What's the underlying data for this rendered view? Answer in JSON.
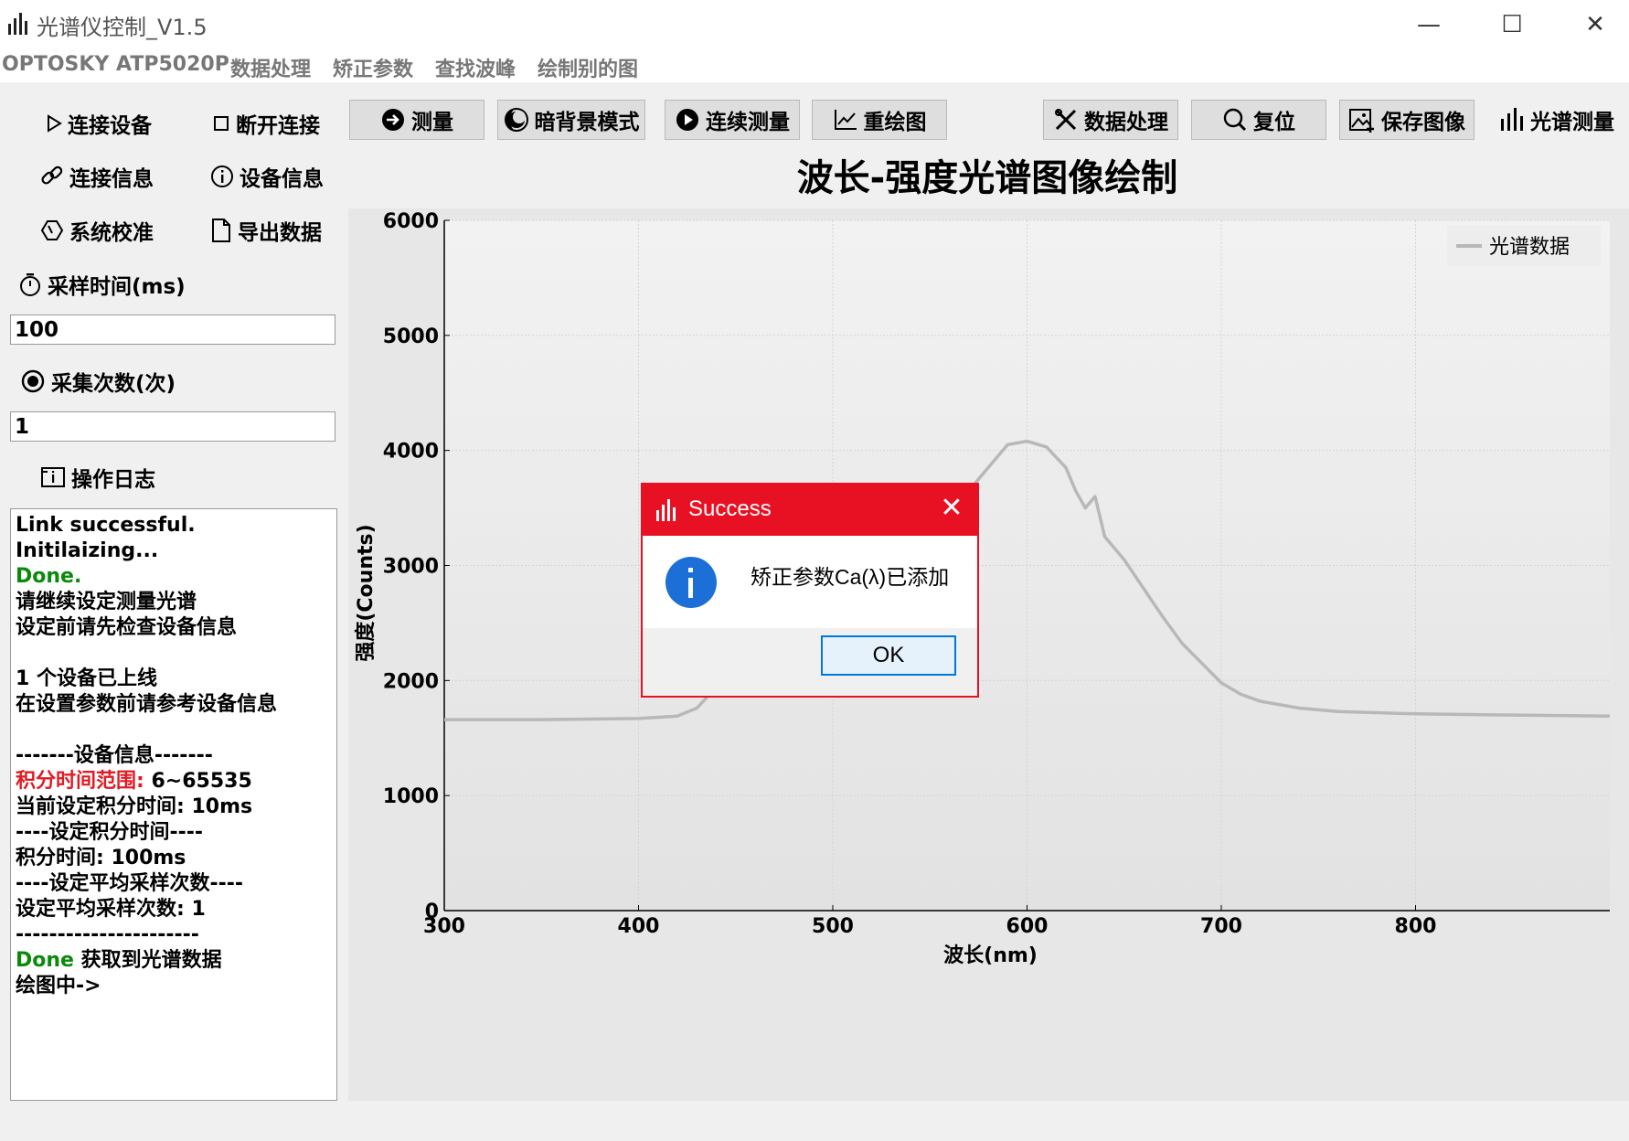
{
  "window": {
    "title": "光谱仪控制_V1.5",
    "icon": "spectrum-bars-icon",
    "controls": [
      "minimize-icon",
      "maximize-icon",
      "close-icon"
    ]
  },
  "menu": [
    "OPTOSKY ATP5020P",
    "数据处理",
    "矫正参数",
    "查找波峰",
    "绘制别的图"
  ],
  "sidebar": {
    "connect": "连接设备",
    "disconnect": "断开连接",
    "link_info": "连接信息",
    "device_info": "设备信息",
    "calibrate": "系统校准",
    "export": "导出数据",
    "sample_time_label": "采样时间(ms)",
    "sample_time_value": "100",
    "collect_count_label": "采集次数(次)",
    "collect_count_value": "1",
    "log_label": "操作日志"
  },
  "log": {
    "l1": "Link successful.",
    "l2": "Initilaizing...",
    "l3": "Done.",
    "l4": "请继续设定测量光谱",
    "l5": "设定前请先检查设备信息",
    "l6": "1 个设备已上线",
    "l7": "在设置参数前请参考设备信息",
    "l8": "-------设备信息-------",
    "l9a": "积分时间范围:",
    "l9b": " 6~65535",
    "l10": "当前设定积分时间: 10ms",
    "l11": "----设定积分时间----",
    "l12": "积分时间: 100ms",
    "l13": "----设定平均采样次数----",
    "l14": "设定平均采样次数: 1",
    "l15": "----------------------",
    "l16a": "Done",
    "l16b": " 获取到光谱数据",
    "l17": "绘图中->"
  },
  "toolbar": {
    "measure": "测量",
    "dark_mode": "暗背景模式",
    "continuous": "连续测量",
    "redraw": "重绘图",
    "data_processing": "数据处理",
    "reset": "复位",
    "save_image": "保存图像",
    "spectrum_measure": "光谱测量"
  },
  "chart_data": {
    "type": "line",
    "title": "波长-强度光谱图像绘制",
    "xlabel": "波长(nm)",
    "ylabel": "强度(Counts)",
    "xlim": [
      300,
      900
    ],
    "ylim": [
      0,
      6000
    ],
    "x_ticks": [
      300,
      400,
      500,
      600,
      700,
      800
    ],
    "y_ticks": [
      0,
      1000,
      2000,
      3000,
      4000,
      5000,
      6000
    ],
    "grid": true,
    "legend_position": "top-right",
    "series": [
      {
        "name": "光谱数据",
        "color": "#b8b8b8",
        "x": [
          300,
          350,
          400,
          420,
          430,
          435,
          440,
          445,
          450,
          455,
          460,
          465,
          470,
          475,
          480,
          490,
          500,
          510,
          520,
          530,
          540,
          550,
          560,
          570,
          580,
          590,
          600,
          610,
          620,
          625,
          630,
          635,
          640,
          650,
          660,
          670,
          680,
          690,
          700,
          710,
          720,
          740,
          760,
          800,
          850,
          900
        ],
        "y": [
          1660,
          1660,
          1670,
          1690,
          1760,
          1850,
          2000,
          2300,
          2650,
          2700,
          2550,
          2400,
          2250,
          2150,
          2160,
          2220,
          2400,
          2580,
          2750,
          2950,
          3150,
          3350,
          3500,
          3650,
          3850,
          4050,
          4080,
          4030,
          3850,
          3650,
          3500,
          3600,
          3250,
          3050,
          2800,
          2550,
          2320,
          2150,
          1980,
          1880,
          1820,
          1760,
          1730,
          1710,
          1700,
          1690
        ]
      }
    ]
  },
  "dialog": {
    "title": "Success",
    "icon": "info-icon",
    "message": "矫正参数Ca(λ)已添加",
    "ok": "OK"
  }
}
